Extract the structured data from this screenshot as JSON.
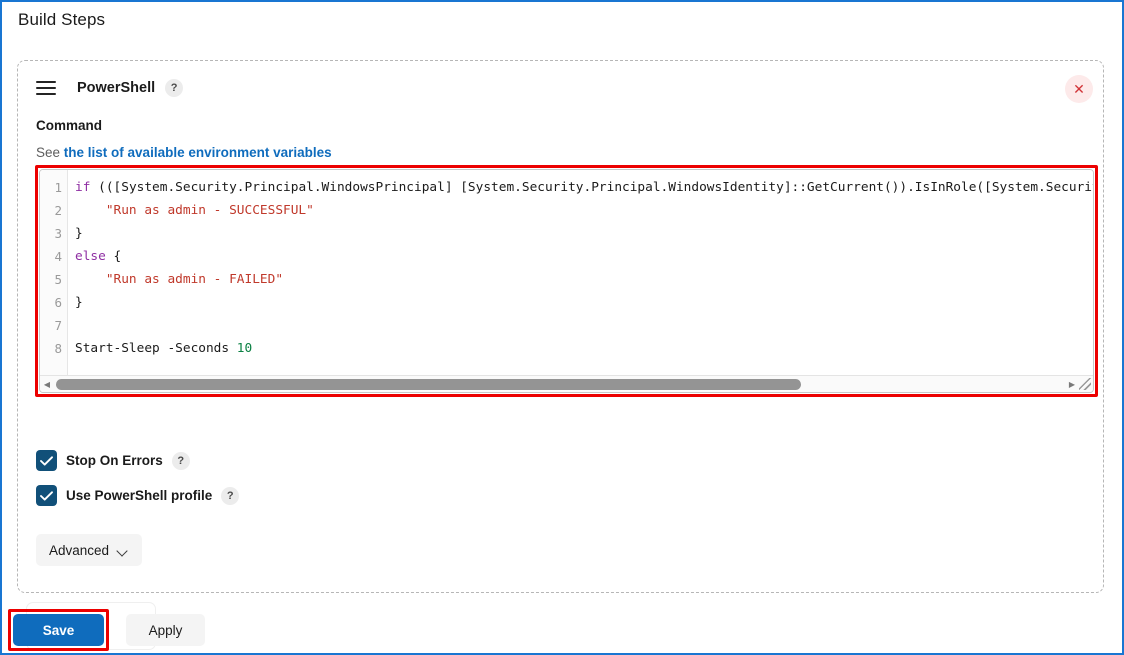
{
  "page": {
    "title": "Build Steps"
  },
  "step": {
    "drag_handle_icon": "drag-handle-icon",
    "name": "PowerShell",
    "help_badge": "?",
    "close_icon": "✕",
    "command_label": "Command",
    "env_prefix": "See",
    "env_link": "the list of available environment variables"
  },
  "editor": {
    "line_numbers": [
      "1",
      "2",
      "3",
      "4",
      "5",
      "6",
      "7",
      "8"
    ],
    "lines": [
      {
        "n": "1",
        "tokens": [
          {
            "t": "if",
            "c": "kw"
          },
          {
            "t": " (([System.Security.Principal.WindowsPrincipal] [System.Security.Principal.WindowsIdentity]::GetCurrent()).IsInRole([System.Securit",
            "c": "plain"
          }
        ]
      },
      {
        "n": "2",
        "tokens": [
          {
            "t": "    \"Run as admin - SUCCESSFUL\"",
            "c": "str"
          }
        ]
      },
      {
        "n": "3",
        "tokens": [
          {
            "t": "}",
            "c": "plain"
          }
        ]
      },
      {
        "n": "4",
        "tokens": [
          {
            "t": "else",
            "c": "kw"
          },
          {
            "t": " {",
            "c": "plain"
          }
        ]
      },
      {
        "n": "5",
        "tokens": [
          {
            "t": "    \"Run as admin - FAILED\"",
            "c": "str"
          }
        ]
      },
      {
        "n": "6",
        "tokens": [
          {
            "t": "}",
            "c": "plain"
          }
        ]
      },
      {
        "n": "7",
        "tokens": [
          {
            "t": "",
            "c": "plain"
          }
        ]
      },
      {
        "n": "8",
        "tokens": [
          {
            "t": "Start-Sleep -Seconds ",
            "c": "plain"
          },
          {
            "t": "10",
            "c": "num"
          }
        ]
      }
    ],
    "scrollbar": {
      "left_arrow_icon": "◀",
      "right_arrow_icon": "▶",
      "resize_grip_icon": "resize-grip-icon"
    },
    "highlight_color": "#ec0000"
  },
  "options": [
    {
      "label": "Stop On Errors",
      "checked": true,
      "help_badge": "?"
    },
    {
      "label": "Use PowerShell profile",
      "checked": true,
      "help_badge": "?"
    }
  ],
  "advanced": {
    "label": "Advanced",
    "chevron_icon": "chevron-down-icon"
  },
  "footer": {
    "save_label": "Save",
    "apply_label": "Apply",
    "save_color": "#0f6cbd",
    "save_highlight_color": "#ec0000"
  }
}
